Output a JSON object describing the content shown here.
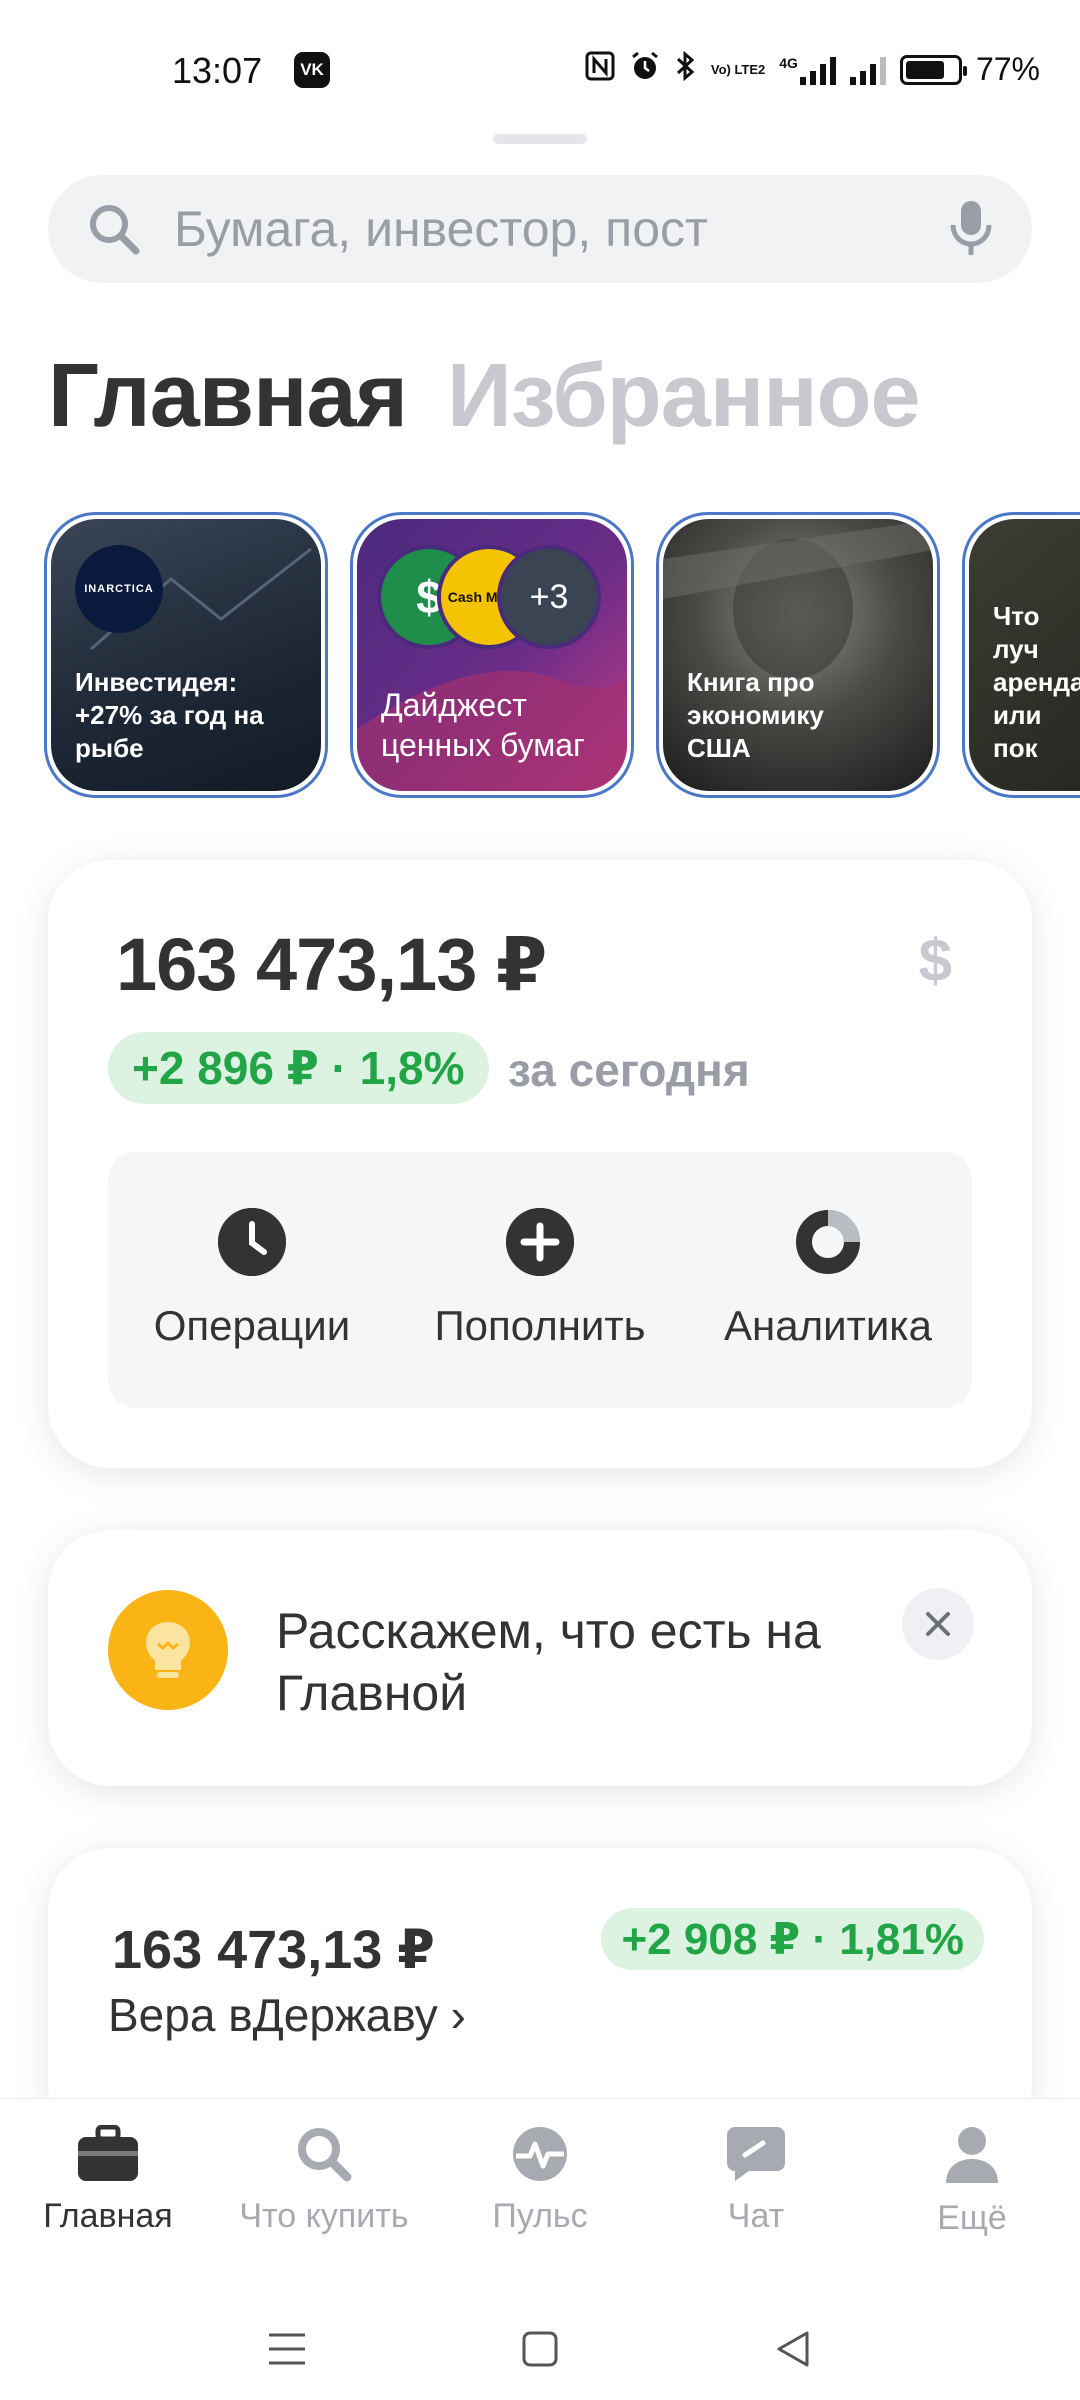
{
  "status_bar": {
    "time": "13:07",
    "vk_badge": "VK",
    "volte": "Vo) LTE2",
    "network": "4G",
    "battery_level": 0.77,
    "battery_text": "77%",
    "icons": [
      "nfc-icon",
      "alarm-icon",
      "bluetooth-icon",
      "volte-icon",
      "signal-icon",
      "battery-icon"
    ]
  },
  "search": {
    "placeholder": "Бумага, инвестор, пост",
    "icons": [
      "search-icon",
      "microphone-icon"
    ]
  },
  "tabs": [
    {
      "label": "Главная",
      "active": true
    },
    {
      "label": "Избранное",
      "active": false
    }
  ],
  "stories": [
    {
      "logo": "INARCTICA",
      "text": "Инвестидея: +27% за год на рыбе"
    },
    {
      "badge_1": "$",
      "badge_2": "Cash Money",
      "badge_count": "+3",
      "text": "Дайджест ценных бумаг"
    },
    {
      "text": "Книга про экономику США"
    },
    {
      "text": "Что луч аренда или пок"
    }
  ],
  "portfolio": {
    "total": "163 473,13 ₽",
    "currency_symbol": "$",
    "change": "+2 896 ₽ · 1,8%",
    "period": "за сегодня",
    "actions": [
      {
        "label": "Операции",
        "icon": "clock-icon"
      },
      {
        "label": "Пополнить",
        "icon": "plus-icon"
      },
      {
        "label": "Аналитика",
        "icon": "donut-chart-icon"
      }
    ]
  },
  "tip": {
    "text": "Расскажем, что есть на Главной",
    "icon": "lightbulb-icon"
  },
  "account": {
    "total": "163 473,13 ₽",
    "change": "+2 908 ₽ · 1,81%",
    "name": "Вера вДержаву ›"
  },
  "bottom_nav": [
    {
      "label": "Главная",
      "icon": "briefcase-icon",
      "active": true
    },
    {
      "label": "Что купить",
      "icon": "search-icon",
      "active": false
    },
    {
      "label": "Пульс",
      "icon": "pulse-icon",
      "active": false
    },
    {
      "label": "Чат",
      "icon": "chat-icon",
      "active": false
    },
    {
      "label": "Ещё",
      "icon": "profile-icon",
      "active": false
    }
  ],
  "colors": {
    "accent_green": "#21a546",
    "green_bg": "#ddf3e2",
    "tip_yellow": "#fbb415",
    "text_dark": "#333333",
    "text_muted": "#9a9da6"
  }
}
